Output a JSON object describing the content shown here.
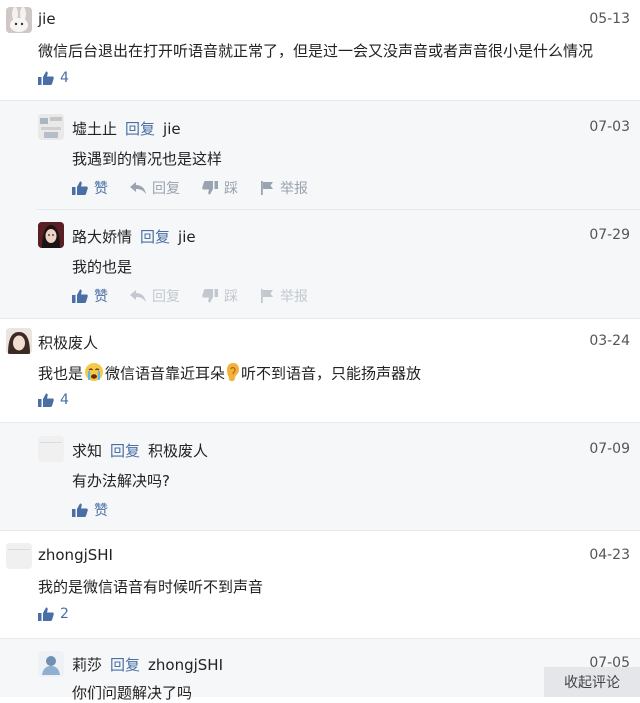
{
  "comments": [
    {
      "user": "jie",
      "date": "05-13",
      "text": "微信后台退出在打开听语音就正常了，但是过一会又没声音或者声音很小是什么情况",
      "likes": "4"
    },
    {
      "user": "积极废人",
      "date": "03-24",
      "text_a": "我也是",
      "text_b": "微信语音靠近耳朵",
      "text_c": "听不到语音，只能扬声器放",
      "likes": "4"
    },
    {
      "user": "zhongjSHI",
      "date": "04-23",
      "text": "我的是微信语音有时候听不到声音",
      "likes": "2"
    }
  ],
  "replies": [
    {
      "user": "墟土止",
      "reply_word": "回复",
      "target": "jie",
      "date": "07-03",
      "text": "我遇到的情况也是这样"
    },
    {
      "user": "路大娇情",
      "reply_word": "回复",
      "target": "jie",
      "date": "07-29",
      "text": "我的也是"
    },
    {
      "user": "求知",
      "reply_word": "回复",
      "target": "积极废人",
      "date": "07-09",
      "text": "有办法解决吗?"
    },
    {
      "user": "莉莎",
      "reply_word": "回复",
      "target": "zhongjSHI",
      "date": "07-05",
      "text": "你们问题解决了吗"
    }
  ],
  "actions": {
    "like": "赞",
    "reply": "回复",
    "dislike": "踩",
    "report": "举报"
  },
  "collapse_label": "收起评论",
  "colors": {
    "accent": "#4a6fa5",
    "muted": "#9aa3b0",
    "reply_bg": "#f6f7f9"
  }
}
